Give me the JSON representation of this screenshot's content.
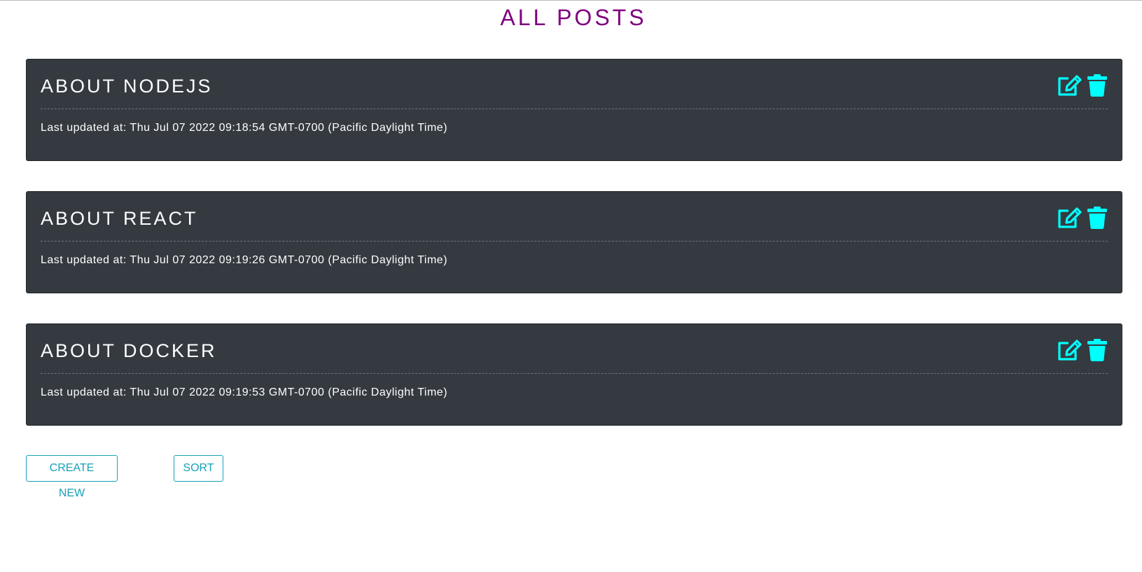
{
  "page": {
    "title": "ALL POSTS"
  },
  "posts": [
    {
      "title": "ABOUT NODEJS",
      "updated": "Last updated at: Thu Jul 07 2022 09:18:54 GMT-0700 (Pacific Daylight Time)"
    },
    {
      "title": "ABOUT REACT",
      "updated": "Last updated at: Thu Jul 07 2022 09:19:26 GMT-0700 (Pacific Daylight Time)"
    },
    {
      "title": "ABOUT DOCKER",
      "updated": "Last updated at: Thu Jul 07 2022 09:19:53 GMT-0700 (Pacific Daylight Time)"
    }
  ],
  "actions": {
    "create_label": "CREATE NEW",
    "sort_label": "SORT"
  },
  "icons": {
    "edit": "edit-icon",
    "delete": "trash-icon"
  },
  "colors": {
    "title": "#800080",
    "card_bg": "#343a40",
    "icon": "#00ffff",
    "button": "#17a2b8"
  }
}
